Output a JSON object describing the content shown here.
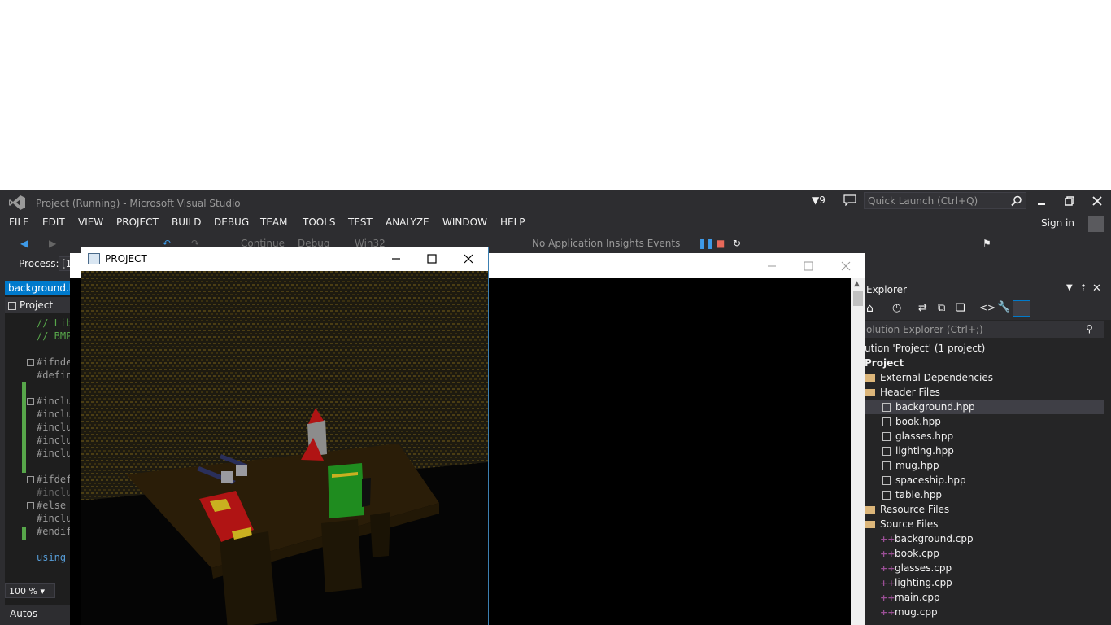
{
  "window": {
    "title": "Project (Running) - Microsoft Visual Studio",
    "notification_count": "9",
    "quick_launch_placeholder": "Quick Launch (Ctrl+Q)"
  },
  "menu": [
    "FILE",
    "EDIT",
    "VIEW",
    "PROJECT",
    "BUILD",
    "DEBUG",
    "TEAM",
    "TOOLS",
    "TEST",
    "ANALYZE",
    "WINDOW",
    "HELP"
  ],
  "account": {
    "signin": "Sign in"
  },
  "toolbar": {
    "continue_label": "Continue",
    "config": "Debug",
    "platform": "Win32",
    "insights": "No Application Insights Events"
  },
  "process": {
    "label": "Process:",
    "value": "[1"
  },
  "editor": {
    "tab": "background.hpp",
    "project_combo": "Project",
    "zoom": "100 %",
    "lines": [
      {
        "text": "// Lib",
        "kind": "comment"
      },
      {
        "text": "// BMP",
        "kind": "comment"
      },
      {
        "text": "#ifnde",
        "kind": "pre"
      },
      {
        "text": "#defin",
        "kind": "pre"
      },
      {
        "text": "#inclu",
        "kind": "pre"
      },
      {
        "text": "#inclu",
        "kind": "pre"
      },
      {
        "text": "#inclu",
        "kind": "pre"
      },
      {
        "text": "#inclu",
        "kind": "pre"
      },
      {
        "text": "#inclu",
        "kind": "pre"
      },
      {
        "text": "#ifdef",
        "kind": "pre"
      },
      {
        "text": "#inclu",
        "kind": "pre"
      },
      {
        "text": "#else",
        "kind": "pre"
      },
      {
        "text": "#inclu",
        "kind": "pre"
      },
      {
        "text": "#endif",
        "kind": "pre"
      },
      {
        "text": "using",
        "kind": "kw"
      }
    ]
  },
  "autos": {
    "label": "Autos"
  },
  "gl_window": {
    "title": "PROJECT"
  },
  "solution_explorer": {
    "title": "Explorer",
    "search_placeholder": "olution Explorer (Ctrl+;)",
    "solution": "ution 'Project' (1 project)",
    "project": "Project",
    "external": "External Dependencies",
    "header_folder": "Header Files",
    "headers": [
      "background.hpp",
      "book.hpp",
      "glasses.hpp",
      "lighting.hpp",
      "mug.hpp",
      "spaceship.hpp",
      "table.hpp"
    ],
    "resource_folder": "Resource Files",
    "source_folder": "Source Files",
    "sources": [
      "background.cpp",
      "book.cpp",
      "glasses.cpp",
      "lighting.cpp",
      "main.cpp",
      "mug.cpp"
    ]
  },
  "colors": {
    "accent": "#007acc",
    "chrome": "#2d2d30",
    "editor_bg": "#1e1e1e"
  }
}
